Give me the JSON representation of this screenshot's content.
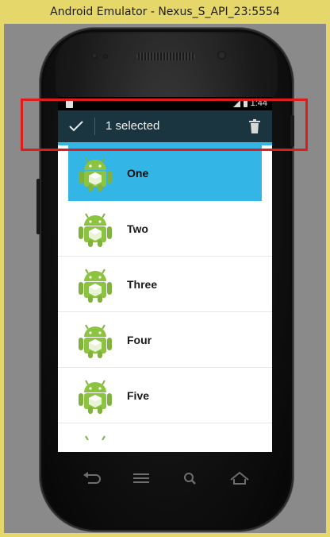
{
  "window": {
    "title": "Android Emulator - Nexus_S_API_23:5554"
  },
  "status_bar": {
    "time": "1:44"
  },
  "action_mode": {
    "selected_text": "1 selected",
    "done_icon": "check-icon",
    "delete_icon": "trash-icon"
  },
  "list": {
    "items": [
      {
        "label": "One",
        "selected": true
      },
      {
        "label": "Two",
        "selected": false
      },
      {
        "label": "Three",
        "selected": false
      },
      {
        "label": "Four",
        "selected": false
      },
      {
        "label": "Five",
        "selected": false
      }
    ]
  },
  "navbar": {
    "buttons": [
      "back-icon",
      "menu-icon",
      "search-icon",
      "home-icon"
    ]
  },
  "colors": {
    "accent": "#33b5e5",
    "action_bar": "#1b3540",
    "highlight": "#e01b1b"
  }
}
